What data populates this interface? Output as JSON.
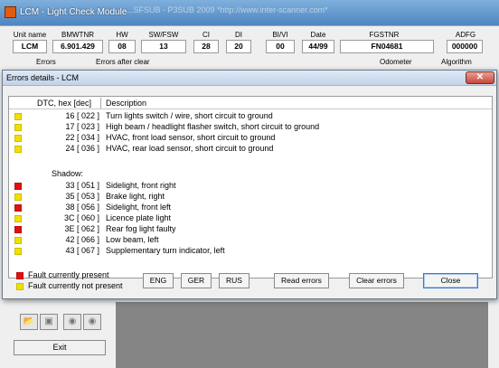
{
  "main_window": {
    "title": "LCM - Light Check Module",
    "behind_title": "...SFSUB - P3SUB 2009 *http://www.inter-scanner.com*",
    "headers": [
      "Unit name",
      "BMWTNR",
      "HW",
      "SW/FSW",
      "CI",
      "DI",
      "BI/VI",
      "Date",
      "FGSTNR",
      "ADFG"
    ],
    "values": [
      "LCM",
      "6.901.429",
      "08",
      "13",
      "28",
      "20",
      "00",
      "44/99",
      "FN04681",
      "000000"
    ],
    "row2_labels": {
      "errors": "Errors",
      "errors_after_clear": "Errors after clear",
      "odometer": "Odometer",
      "algorithm": "Algorithm"
    },
    "exit_label": "Exit",
    "toolbar_icons": [
      "open-folder-icon",
      "save-disk-icon",
      "binoculars-icon",
      "binoculars-icon"
    ]
  },
  "dialog": {
    "title": "Errors details - LCM",
    "close_glyph": "✕",
    "columns": {
      "dtc": "DTC, hex [dec]",
      "description": "Description"
    },
    "active_errors": [
      {
        "code": "16 [ 022 ]",
        "description": "Turn lights switch / wire, short circuit to ground",
        "status": "not_present"
      },
      {
        "code": "17 [ 023 ]",
        "description": "High beam / headlight flasher switch, short circuit to ground",
        "status": "not_present"
      },
      {
        "code": "22 [ 034 ]",
        "description": "HVAC, front load sensor, short circuit to ground",
        "status": "not_present"
      },
      {
        "code": "24 [ 036 ]",
        "description": "HVAC, rear load sensor, short circuit to ground",
        "status": "not_present"
      }
    ],
    "shadow_label": "Shadow:",
    "shadow_errors": [
      {
        "code": "33 [ 051 ]",
        "description": "Sidelight, front right",
        "status": "present"
      },
      {
        "code": "35 [ 053 ]",
        "description": "Brake light, right",
        "status": "not_present"
      },
      {
        "code": "38 [ 056 ]",
        "description": "Sidelight, front left",
        "status": "present"
      },
      {
        "code": "3C [ 060 ]",
        "description": "Licence plate light",
        "status": "not_present"
      },
      {
        "code": "3E [ 062 ]",
        "description": "Rear fog light faulty",
        "status": "present"
      },
      {
        "code": "42 [ 066 ]",
        "description": "Low beam, left",
        "status": "not_present"
      },
      {
        "code": "43 [ 067 ]",
        "description": "Supplementary turn indicator, left",
        "status": "not_present"
      }
    ],
    "legend": {
      "present": "Fault currently present",
      "not_present": "Fault currently not present"
    },
    "buttons": {
      "eng": "ENG",
      "ger": "GER",
      "rus": "RUS",
      "read_errors": "Read errors",
      "clear_errors": "Clear errors",
      "close": "Close"
    },
    "colors": {
      "present": "#e01010",
      "not_present": "#f0e000"
    }
  }
}
